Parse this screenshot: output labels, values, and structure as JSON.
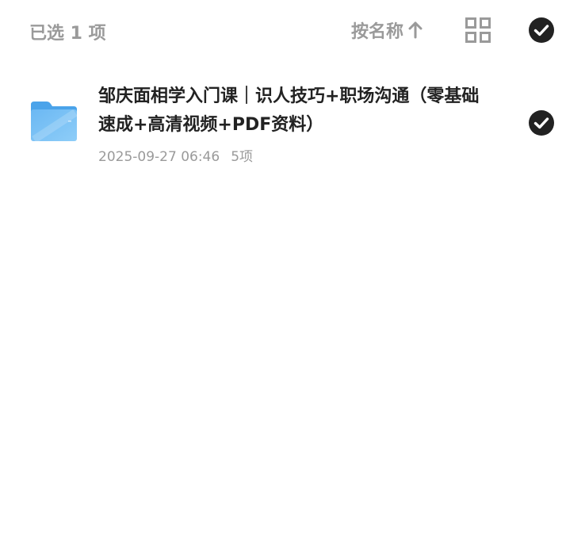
{
  "toolbar": {
    "selected_count_label": "已选 1 项",
    "sort_label": "按名称",
    "sort_icon": "arrow-up-icon",
    "view_icon": "grid-view-icon",
    "select_all_icon": "check-circle-icon"
  },
  "colors": {
    "muted_text": "#9a9a9a",
    "primary_text": "#222222",
    "check_fill": "#222222",
    "folder_blue": "#5aaef0",
    "folder_blue_light": "#8cc8f7"
  },
  "files": [
    {
      "name": "邹庆面相学入门课｜识人技巧+职场沟通（零基础速成+高清视频+PDF资料）",
      "date": "2025-09-27 06:46",
      "count": "5项",
      "icon": "folder-icon",
      "selected_icon": "check-circle-icon"
    }
  ]
}
